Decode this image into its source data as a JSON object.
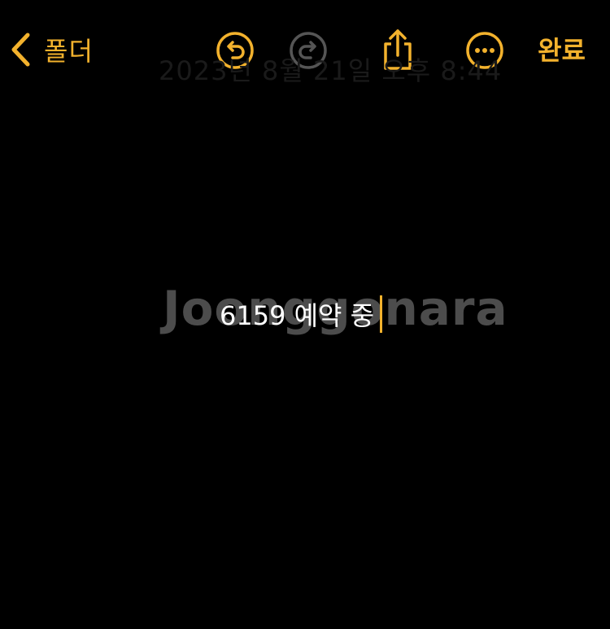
{
  "toolbar": {
    "back_label": "폴더",
    "undo_icon": "undo-circle-icon",
    "redo_icon": "redo-circle-icon",
    "share_icon": "share-icon",
    "more_icon": "ellipsis-circle-icon",
    "done_label": "완료"
  },
  "note": {
    "date_text": "2023년 8월 21일 오후 8:44",
    "body_text": "6159 예약 중"
  },
  "watermark": {
    "text": "Joonggonara"
  },
  "colors": {
    "background": "#000000",
    "accent": "#f3b22d",
    "disabled": "#555555",
    "text": "#ffffff"
  }
}
